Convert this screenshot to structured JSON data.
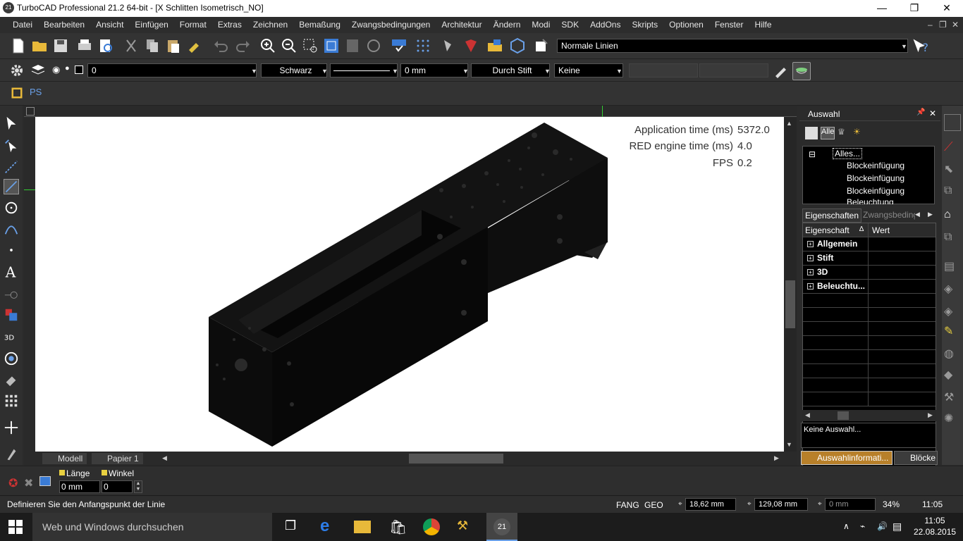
{
  "window": {
    "title": "TurboCAD Professional 21.2 64-bit - [X Schlitten Isometrisch_NO]",
    "app_icon": "21",
    "min": "—",
    "max": "❐",
    "close": "✕"
  },
  "menu": [
    "Datei",
    "Bearbeiten",
    "Ansicht",
    "Einfügen",
    "Format",
    "Extras",
    "Zeichnen",
    "Bemaßung",
    "Zwangsbedingungen",
    "Architektur",
    "Ändern",
    "Modi",
    "SDK",
    "AddOns",
    "Skripts",
    "Optionen",
    "Fenster",
    "Hilfe"
  ],
  "mdi": {
    "min": "–",
    "restore": "❐",
    "close": "✕"
  },
  "toolbar1": {
    "line_style": "Normale Linien"
  },
  "toolbar2": {
    "layer": "0",
    "color": "Schwarz",
    "width": "0 mm",
    "fill": "Durch Stift",
    "pattern": "Keine"
  },
  "toolbar3": {
    "ps_label": "PS"
  },
  "viewport": {
    "app_time_label": "Application time (ms)",
    "app_time_value": "5372.0",
    "red_label": "RED engine time (ms)",
    "red_value": "4.0",
    "fps_label": "FPS",
    "fps_value": "0.2"
  },
  "tabs": {
    "model": "Modell",
    "paper": "Papier 1"
  },
  "panel": {
    "title": "Auswahl",
    "filter_all": "Alle",
    "tree": [
      "Alles...",
      "Blockeinfügung",
      "Blockeinfügung",
      "Blockeinfügung",
      "Beleuchtung"
    ],
    "tab_props": "Eigenschaften",
    "tab_constraints": "Zwangsbeding",
    "col_property": "Eigenschaft",
    "col_value": "Wert",
    "sort_glyph": "∆",
    "groups": [
      "Allgemein",
      "Stift",
      "3D",
      "Beleuchtu..."
    ],
    "info": "Keine Auswahl...",
    "bottom_tab1": "Auswahlinformati...",
    "bottom_tab2": "Blöcke"
  },
  "cmd": {
    "length_label": "Länge",
    "length_value": "0 mm",
    "angle_label": "Winkel",
    "angle_value": "0"
  },
  "status": {
    "prompt": "Definieren Sie den Anfangspunkt der Linie",
    "snap": "FANG",
    "geo": "GEO",
    "x": "18,62 mm",
    "y": "129,08 mm",
    "z": "0 mm",
    "zoom": "34%",
    "time": "11:05"
  },
  "taskbar": {
    "search": "Web und Windows durchsuchen",
    "clock_time": "11:05",
    "clock_date": "22.08.2015",
    "app_badge": "21"
  },
  "colors": {
    "accent_blue": "#4a90e2",
    "panel_bg": "#2b2b2b"
  }
}
